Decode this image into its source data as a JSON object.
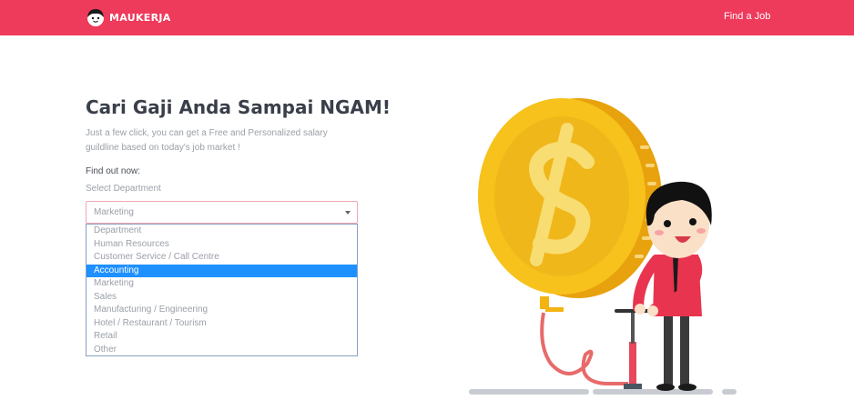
{
  "brand": {
    "name": "MAUKERJA"
  },
  "nav": {
    "find_job": "Find a Job"
  },
  "hero": {
    "title": "Cari Gaji Anda Sampai NGAM!",
    "subtitle": "Just a few click, you can get a Free and Personalized salary guildline based on today's job market !",
    "find_out": "Find out now:",
    "select_label": "Select Department"
  },
  "department_select": {
    "value": "Marketing",
    "options": [
      "Department",
      "Human Resources",
      "Customer Service / Call Centre",
      "Accounting",
      "Marketing",
      "Sales",
      "Manufacturing / Engineering",
      "Hotel / Restaurant / Tourism",
      "Retail",
      "Other"
    ],
    "highlighted": "Accounting"
  },
  "colors": {
    "brand": "#ee3a5b",
    "highlight": "#1e90ff",
    "coin": "#f6c21b"
  },
  "icons": {
    "logo": "mascot-face-icon",
    "caret": "chevron-down-icon",
    "illustration": "coin-pump-illustration"
  }
}
